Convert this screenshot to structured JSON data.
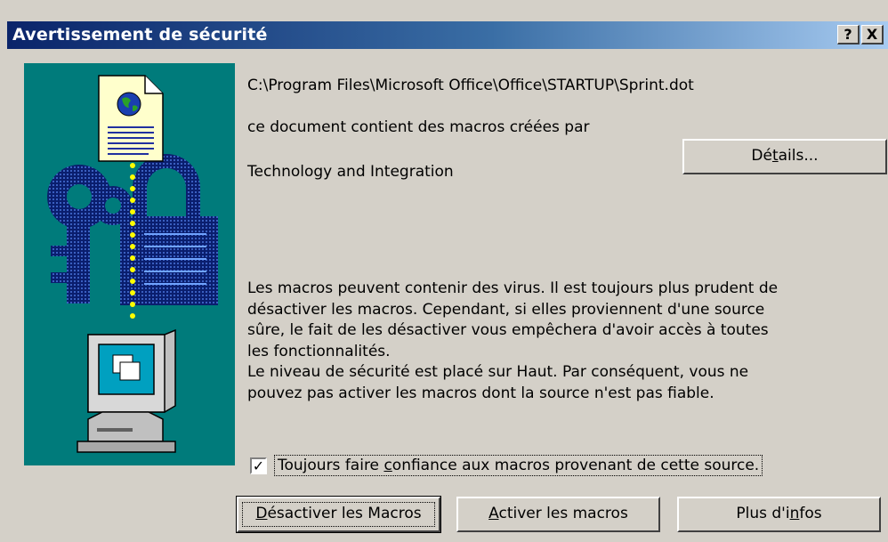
{
  "window": {
    "title": "Avertissement de sécurité",
    "help_label": "?",
    "close_label": "X"
  },
  "info": {
    "file_path": "C:\\Program Files\\Microsoft Office\\Office\\STARTUP\\Sprint.dot",
    "macro_intro": "ce document contient des macros créées par",
    "publisher": "Technology and Integration"
  },
  "details_button": {
    "pre": "Dé",
    "ul": "t",
    "post": "ails..."
  },
  "warning_lines": [
    "Les macros peuvent contenir des virus. Il est toujours plus prudent de",
    "désactiver les macros. Cependant, si elles proviennent d'une source",
    "sûre, le fait de les désactiver vous empêchera d'avoir accès à toutes",
    "les fonctionnalités.",
    "Le niveau de sécurité est placé sur Haut. Par conséquent, vous ne",
    "pouvez pas activer les macros dont la source n'est pas fiable."
  ],
  "trust_checkbox": {
    "checked": true,
    "mark": "✓",
    "pre": "Toujours faire ",
    "ul": "c",
    "post": "onfiance aux macros provenant de cette source."
  },
  "buttons": {
    "disable": {
      "pre": "",
      "ul": "D",
      "post": "ésactiver les Macros"
    },
    "enable": {
      "pre": "",
      "ul": "A",
      "post": "ctiver les macros"
    },
    "more": {
      "pre": "Plus d'i",
      "ul": "n",
      "post": "fos"
    }
  },
  "colors": {
    "title_gradient_start": "#0a246a",
    "title_gradient_end": "#a6caf0",
    "illustration_bg": "#007b7b",
    "dialog_bg": "#d4d0c8"
  },
  "icons": [
    "document-icon",
    "globe-icon",
    "key-icon",
    "padlock-icon",
    "computer-icon"
  ]
}
